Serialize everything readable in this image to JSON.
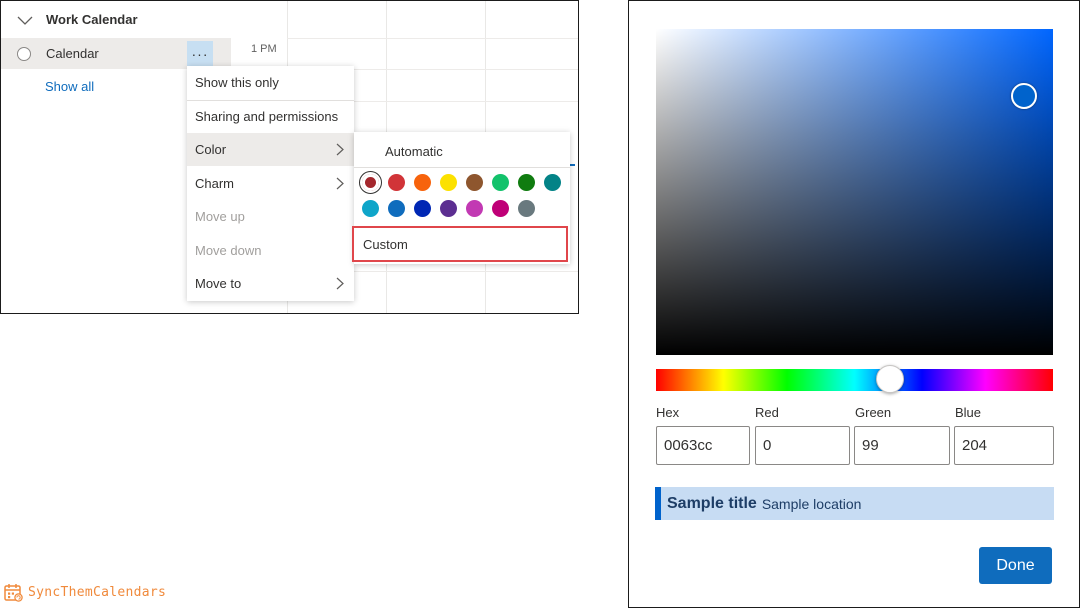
{
  "left_panel": {
    "calendar_group": "Work Calendar",
    "calendar_name": "Calendar",
    "more_label": "···",
    "show_all": "Show all",
    "time_label": "1 PM"
  },
  "context_menu": {
    "items": [
      {
        "label": "Show this only",
        "enabled": true
      },
      {
        "label": "Sharing and permissions",
        "enabled": true
      },
      {
        "label": "Color",
        "enabled": true,
        "submenu": true,
        "active": true
      },
      {
        "label": "Charm",
        "enabled": true,
        "submenu": true
      },
      {
        "label": "Move up",
        "enabled": false
      },
      {
        "label": "Move down",
        "enabled": false
      },
      {
        "label": "Move to",
        "enabled": true,
        "submenu": true
      }
    ]
  },
  "color_submenu": {
    "automatic_label": "Automatic",
    "custom_label": "Custom",
    "swatches": [
      {
        "color": "#a4262c",
        "selected": true
      },
      {
        "color": "#d13438",
        "selected": false
      },
      {
        "color": "#f7630c",
        "selected": false
      },
      {
        "color": "#fce100",
        "selected": false
      },
      {
        "color": "#8e562e",
        "selected": false
      },
      {
        "color": "#13c26b",
        "selected": false
      },
      {
        "color": "#107c10",
        "selected": false
      },
      {
        "color": "#038387",
        "selected": false
      },
      {
        "color": "#0ea5c9",
        "selected": false
      },
      {
        "color": "#0f6cbd",
        "selected": false
      },
      {
        "color": "#0027b4",
        "selected": false
      },
      {
        "color": "#5c2e91",
        "selected": false
      },
      {
        "color": "#c239b3",
        "selected": false
      },
      {
        "color": "#bf0077",
        "selected": false
      },
      {
        "color": "#69797e",
        "selected": false
      }
    ]
  },
  "color_picker": {
    "labels": {
      "hex": "Hex",
      "red": "Red",
      "green": "Green",
      "blue": "Blue"
    },
    "values": {
      "hex": "0063cc",
      "red": "0",
      "green": "99",
      "blue": "204"
    },
    "selected_color": "#0063cc",
    "sample_title": "Sample title",
    "sample_location": "Sample location",
    "done_label": "Done"
  },
  "brand": {
    "name": "SyncThemCalendars",
    "accent": "#f08a3c"
  }
}
